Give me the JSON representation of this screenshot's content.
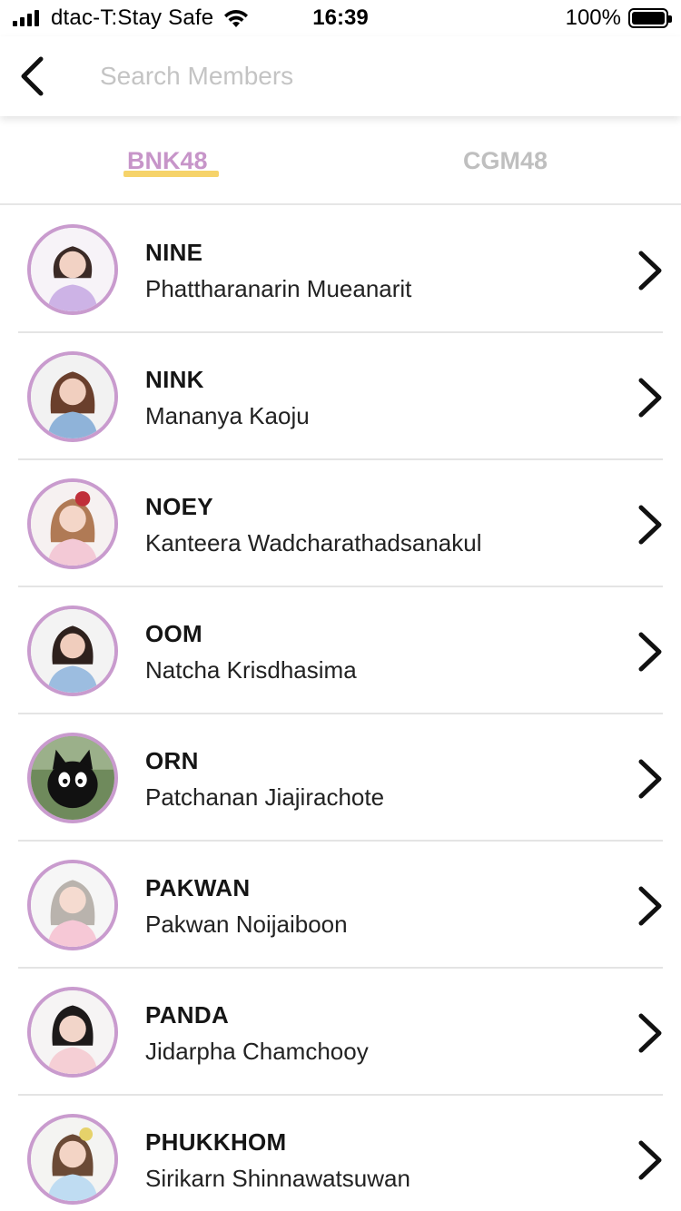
{
  "status_bar": {
    "carrier": "dtac-T:Stay Safe",
    "time": "16:39",
    "battery": "100%",
    "icons": [
      "signal-icon",
      "wifi-icon",
      "battery-icon"
    ]
  },
  "header": {
    "back_icon": "chevron-left-icon",
    "search_placeholder": "Search Members",
    "search_value": ""
  },
  "tabs": [
    {
      "label": "BNK48",
      "active": true
    },
    {
      "label": "CGM48",
      "active": false
    }
  ],
  "colors": {
    "accent_purple": "#c795c9",
    "underline_yellow": "#f6d36a",
    "avatar_border": "#c99bce",
    "inactive_tab": "#bfbfbf"
  },
  "members": [
    {
      "nickname": "NINE",
      "name": "Phattharanarin Mueanarit"
    },
    {
      "nickname": "NINK",
      "name": "Mananya Kaoju"
    },
    {
      "nickname": "NOEY",
      "name": "Kanteera Wadcharathadsanakul"
    },
    {
      "nickname": "OOM",
      "name": "Natcha Krisdhasima"
    },
    {
      "nickname": "ORN",
      "name": "Patchanan Jiajirachote"
    },
    {
      "nickname": "PAKWAN",
      "name": "Pakwan Noijaiboon"
    },
    {
      "nickname": "PANDA",
      "name": "Jidarpha Chamchooy"
    },
    {
      "nickname": "PHUKKHOM",
      "name": "Sirikarn Shinnawatsuwan"
    }
  ]
}
